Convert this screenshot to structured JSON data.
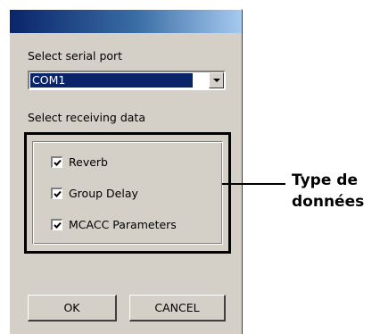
{
  "dialog": {
    "serial_port_label": "Select serial port",
    "serial_port_value": "COM1",
    "receiving_label": "Select receiving data",
    "options": [
      {
        "label": "Reverb",
        "checked": true
      },
      {
        "label": "Group Delay",
        "checked": true
      },
      {
        "label": "MCACC Parameters",
        "checked": true
      }
    ],
    "ok_label": "OK",
    "cancel_label": "CANCEL"
  },
  "annotation": {
    "line1": "Type de",
    "line2": "données"
  },
  "colors": {
    "dialog_bg": "#d4d0c8",
    "selection": "#0a246a",
    "title_gradient_start": "#0a246a",
    "title_gradient_end": "#a6caf0"
  },
  "icons": [
    "chevron-down-icon",
    "checkmark-icon"
  ]
}
